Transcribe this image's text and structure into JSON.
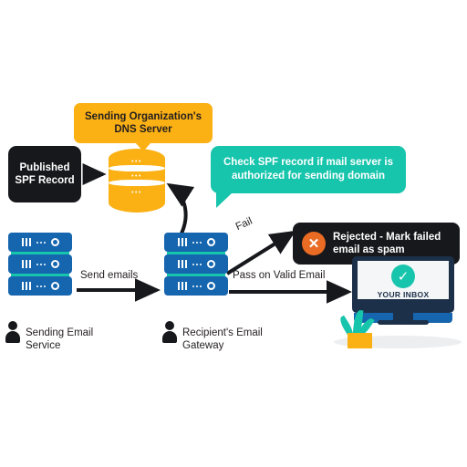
{
  "diagram": {
    "title_callout": "Sending Organization's DNS Server",
    "spf_record_box": "Published SPF Record",
    "check_bubble": "Check SPF record if mail server is authorized for sending domain",
    "rejected_box": "Rejected - Mark failed email as spam",
    "rejected_icon": "x-circle-icon",
    "inbox_label": "YOUR INBOX",
    "inbox_icon": "check-circle-icon",
    "database_icon": "database-cylinder-icon",
    "plant_icon": "potted-plant-icon",
    "monitor_icon": "desktop-monitor-icon"
  },
  "nodes": [
    {
      "id": "sending-email-service",
      "label": "Sending Email Service",
      "person_icon": "person-icon",
      "server_icon": "server-stack-icon"
    },
    {
      "id": "recipient-email-gateway",
      "label": "Recipient's Email Gateway",
      "person_icon": "person-icon",
      "server_icon": "server-stack-icon"
    }
  ],
  "arrows": [
    {
      "id": "send-emails",
      "label": "Send emails"
    },
    {
      "id": "pass-on-valid-email",
      "label": "Pass on Valid Email"
    },
    {
      "id": "fail",
      "label": "Fail"
    },
    {
      "id": "spf-to-dns",
      "label": ""
    },
    {
      "id": "gateway-to-dns-query",
      "label": ""
    }
  ],
  "colors": {
    "amber": "#FBB014",
    "teal": "#17C4AC",
    "blue": "#1565AF",
    "navy": "#1D3049",
    "black": "#17181C",
    "orange": "#EA6B23",
    "white": "#FFFFFF",
    "text": "#231F20",
    "floor": "#ECEEF0"
  }
}
